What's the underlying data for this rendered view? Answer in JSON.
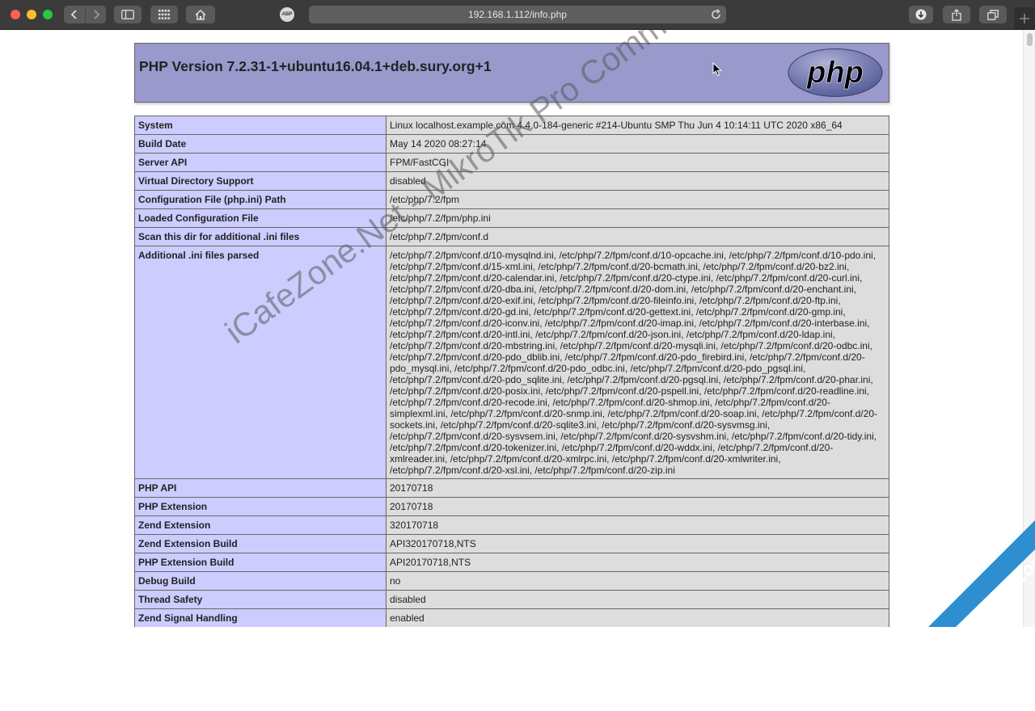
{
  "browser": {
    "url": "192.168.1.112/info.php",
    "adblock_label": "ABP"
  },
  "header": {
    "title": "PHP Version 7.2.31-1+ubuntu16.04.1+deb.sury.org+1",
    "logo_text": "php"
  },
  "rows": [
    {
      "key": "System",
      "value": "Linux localhost.example.com 4.4.0-184-generic #214-Ubuntu SMP Thu Jun 4 10:14:11 UTC 2020 x86_64"
    },
    {
      "key": "Build Date",
      "value": "May 14 2020 08:27:14"
    },
    {
      "key": "Server API",
      "value": "FPM/FastCGI"
    },
    {
      "key": "Virtual Directory Support",
      "value": "disabled"
    },
    {
      "key": "Configuration File (php.ini) Path",
      "value": "/etc/php/7.2/fpm"
    },
    {
      "key": "Loaded Configuration File",
      "value": "/etc/php/7.2/fpm/php.ini"
    },
    {
      "key": "Scan this dir for additional .ini files",
      "value": "/etc/php/7.2/fpm/conf.d"
    },
    {
      "key": "Additional .ini files parsed",
      "value": "/etc/php/7.2/fpm/conf.d/10-mysqlnd.ini, /etc/php/7.2/fpm/conf.d/10-opcache.ini, /etc/php/7.2/fpm/conf.d/10-pdo.ini, /etc/php/7.2/fpm/conf.d/15-xml.ini, /etc/php/7.2/fpm/conf.d/20-bcmath.ini, /etc/php/7.2/fpm/conf.d/20-bz2.ini, /etc/php/7.2/fpm/conf.d/20-calendar.ini, /etc/php/7.2/fpm/conf.d/20-ctype.ini, /etc/php/7.2/fpm/conf.d/20-curl.ini, /etc/php/7.2/fpm/conf.d/20-dba.ini, /etc/php/7.2/fpm/conf.d/20-dom.ini, /etc/php/7.2/fpm/conf.d/20-enchant.ini, /etc/php/7.2/fpm/conf.d/20-exif.ini, /etc/php/7.2/fpm/conf.d/20-fileinfo.ini, /etc/php/7.2/fpm/conf.d/20-ftp.ini, /etc/php/7.2/fpm/conf.d/20-gd.ini, /etc/php/7.2/fpm/conf.d/20-gettext.ini, /etc/php/7.2/fpm/conf.d/20-gmp.ini, /etc/php/7.2/fpm/conf.d/20-iconv.ini, /etc/php/7.2/fpm/conf.d/20-imap.ini, /etc/php/7.2/fpm/conf.d/20-interbase.ini, /etc/php/7.2/fpm/conf.d/20-intl.ini, /etc/php/7.2/fpm/conf.d/20-json.ini, /etc/php/7.2/fpm/conf.d/20-ldap.ini, /etc/php/7.2/fpm/conf.d/20-mbstring.ini, /etc/php/7.2/fpm/conf.d/20-mysqli.ini, /etc/php/7.2/fpm/conf.d/20-odbc.ini, /etc/php/7.2/fpm/conf.d/20-pdo_dblib.ini, /etc/php/7.2/fpm/conf.d/20-pdo_firebird.ini, /etc/php/7.2/fpm/conf.d/20-pdo_mysql.ini, /etc/php/7.2/fpm/conf.d/20-pdo_odbc.ini, /etc/php/7.2/fpm/conf.d/20-pdo_pgsql.ini, /etc/php/7.2/fpm/conf.d/20-pdo_sqlite.ini, /etc/php/7.2/fpm/conf.d/20-pgsql.ini, /etc/php/7.2/fpm/conf.d/20-phar.ini, /etc/php/7.2/fpm/conf.d/20-posix.ini, /etc/php/7.2/fpm/conf.d/20-pspell.ini, /etc/php/7.2/fpm/conf.d/20-readline.ini, /etc/php/7.2/fpm/conf.d/20-recode.ini, /etc/php/7.2/fpm/conf.d/20-shmop.ini, /etc/php/7.2/fpm/conf.d/20-simplexml.ini, /etc/php/7.2/fpm/conf.d/20-snmp.ini, /etc/php/7.2/fpm/conf.d/20-soap.ini, /etc/php/7.2/fpm/conf.d/20-sockets.ini, /etc/php/7.2/fpm/conf.d/20-sqlite3.ini, /etc/php/7.2/fpm/conf.d/20-sysvmsg.ini, /etc/php/7.2/fpm/conf.d/20-sysvsem.ini, /etc/php/7.2/fpm/conf.d/20-sysvshm.ini, /etc/php/7.2/fpm/conf.d/20-tidy.ini, /etc/php/7.2/fpm/conf.d/20-tokenizer.ini, /etc/php/7.2/fpm/conf.d/20-wddx.ini, /etc/php/7.2/fpm/conf.d/20-xmlreader.ini, /etc/php/7.2/fpm/conf.d/20-xmlrpc.ini, /etc/php/7.2/fpm/conf.d/20-xmlwriter.ini, /etc/php/7.2/fpm/conf.d/20-xsl.ini, /etc/php/7.2/fpm/conf.d/20-zip.ini"
    },
    {
      "key": "PHP API",
      "value": "20170718"
    },
    {
      "key": "PHP Extension",
      "value": "20170718"
    },
    {
      "key": "Zend Extension",
      "value": "320170718"
    },
    {
      "key": "Zend Extension Build",
      "value": "API320170718,NTS"
    },
    {
      "key": "PHP Extension Build",
      "value": "API20170718,NTS"
    },
    {
      "key": "Debug Build",
      "value": "no"
    },
    {
      "key": "Thread Safety",
      "value": "disabled"
    },
    {
      "key": "Zend Signal Handling",
      "value": "enabled"
    }
  ],
  "watermark": {
    "text": "iCafeZone.Net - MikroTik Pro Community",
    "corner_text": "iCafeZone"
  },
  "colors": {
    "header_bg": "#9999cc",
    "key_bg": "#ccccff",
    "value_bg": "#dddddd",
    "toolbar_bg": "#3b3b3b",
    "corner_bg": "#2e8fd0"
  }
}
